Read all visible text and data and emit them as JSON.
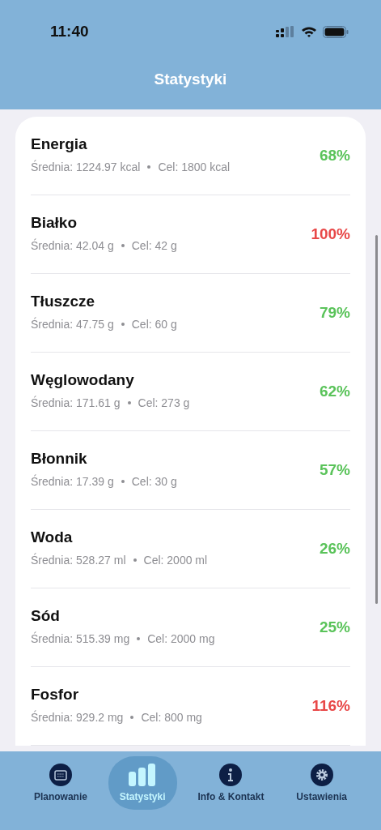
{
  "status_bar": {
    "time": "11:40"
  },
  "header": {
    "title": "Statystyki"
  },
  "nutrients": [
    {
      "name": "Energia",
      "average": "Średnia: 1224.97 kcal",
      "goal": "Cel: 1800 kcal",
      "percent": "68%",
      "color": "#5ac35a"
    },
    {
      "name": "Białko",
      "average": "Średnia: 42.04 g",
      "goal": "Cel: 42 g",
      "percent": "100%",
      "color": "#e84848"
    },
    {
      "name": "Tłuszcze",
      "average": "Średnia: 47.75 g",
      "goal": "Cel: 60 g",
      "percent": "79%",
      "color": "#5ac35a"
    },
    {
      "name": "Węglowodany",
      "average": "Średnia: 171.61 g",
      "goal": "Cel: 273 g",
      "percent": "62%",
      "color": "#5ac35a"
    },
    {
      "name": "Błonnik",
      "average": "Średnia: 17.39 g",
      "goal": "Cel: 30 g",
      "percent": "57%",
      "color": "#5ac35a"
    },
    {
      "name": "Woda",
      "average": "Średnia: 528.27 ml",
      "goal": "Cel: 2000 ml",
      "percent": "26%",
      "color": "#5ac35a"
    },
    {
      "name": "Sód",
      "average": "Średnia: 515.39 mg",
      "goal": "Cel: 2000 mg",
      "percent": "25%",
      "color": "#5ac35a"
    },
    {
      "name": "Fosfor",
      "average": "Średnia: 929.2 mg",
      "goal": "Cel: 800 mg",
      "percent": "116%",
      "color": "#e84848"
    }
  ],
  "tabs": [
    {
      "label": "Planowanie",
      "kind": "calendar",
      "selected": false
    },
    {
      "label": "Statystyki",
      "kind": "chart",
      "selected": true
    },
    {
      "label": "Info & Kontakt",
      "kind": "info",
      "selected": false
    },
    {
      "label": "Ustawienia",
      "kind": "gear",
      "selected": false
    }
  ]
}
